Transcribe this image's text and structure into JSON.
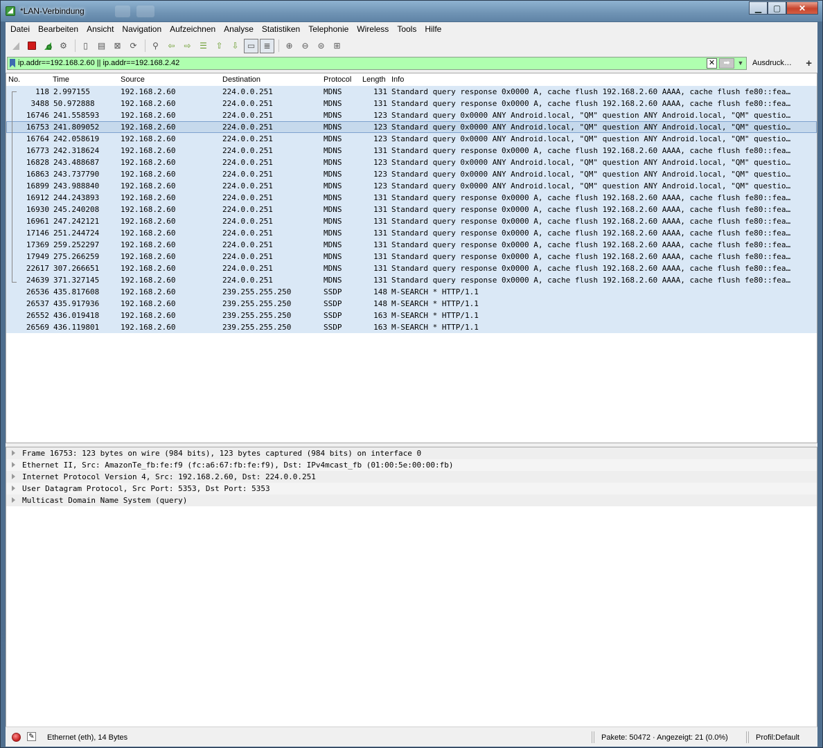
{
  "window": {
    "title": "*LAN-Verbindung"
  },
  "menu": [
    "Datei",
    "Bearbeiten",
    "Ansicht",
    "Navigation",
    "Aufzeichnen",
    "Analyse",
    "Statistiken",
    "Telephonie",
    "Wireless",
    "Tools",
    "Hilfe"
  ],
  "toolbar": {
    "icons": [
      "shark-fin-icon",
      "stop-capture-icon",
      "restart-capture-icon",
      "capture-options-icon",
      "open-file-icon",
      "save-file-icon",
      "close-file-icon",
      "reload-file-icon",
      "find-packet-icon",
      "go-back-icon",
      "go-forward-icon",
      "go-to-packet-icon",
      "first-packet-icon",
      "last-packet-icon",
      "autoscroll-icon",
      "colorize-icon",
      "zoom-in-icon",
      "zoom-out-icon",
      "normal-size-icon",
      "resize-columns-icon"
    ]
  },
  "filter": {
    "value": "ip.addr==192.168.2.60 || ip.addr==192.168.2.42",
    "expression_label": "Ausdruck…",
    "add_label": "+"
  },
  "packet_list": {
    "columns": [
      "No.",
      "Time",
      "Source",
      "Destination",
      "Protocol",
      "Length",
      "Info"
    ],
    "selected_index": 3,
    "rows": [
      {
        "no": "118",
        "time": "2.997155",
        "src": "192.168.2.60",
        "dst": "224.0.0.251",
        "proto": "MDNS",
        "len": "131",
        "info": "Standard query response 0x0000 A, cache flush 192.168.2.60 AAAA, cache flush fe80::fea…"
      },
      {
        "no": "3488",
        "time": "50.972888",
        "src": "192.168.2.60",
        "dst": "224.0.0.251",
        "proto": "MDNS",
        "len": "131",
        "info": "Standard query response 0x0000 A, cache flush 192.168.2.60 AAAA, cache flush fe80::fea…"
      },
      {
        "no": "16746",
        "time": "241.558593",
        "src": "192.168.2.60",
        "dst": "224.0.0.251",
        "proto": "MDNS",
        "len": "123",
        "info": "Standard query 0x0000 ANY Android.local, \"QM\" question ANY Android.local, \"QM\" questio…"
      },
      {
        "no": "16753",
        "time": "241.809052",
        "src": "192.168.2.60",
        "dst": "224.0.0.251",
        "proto": "MDNS",
        "len": "123",
        "info": "Standard query 0x0000 ANY Android.local, \"QM\" question ANY Android.local, \"QM\" questio…"
      },
      {
        "no": "16764",
        "time": "242.058619",
        "src": "192.168.2.60",
        "dst": "224.0.0.251",
        "proto": "MDNS",
        "len": "123",
        "info": "Standard query 0x0000 ANY Android.local, \"QM\" question ANY Android.local, \"QM\" questio…"
      },
      {
        "no": "16773",
        "time": "242.318624",
        "src": "192.168.2.60",
        "dst": "224.0.0.251",
        "proto": "MDNS",
        "len": "131",
        "info": "Standard query response 0x0000 A, cache flush 192.168.2.60 AAAA, cache flush fe80::fea…"
      },
      {
        "no": "16828",
        "time": "243.488687",
        "src": "192.168.2.60",
        "dst": "224.0.0.251",
        "proto": "MDNS",
        "len": "123",
        "info": "Standard query 0x0000 ANY Android.local, \"QM\" question ANY Android.local, \"QM\" questio…"
      },
      {
        "no": "16863",
        "time": "243.737790",
        "src": "192.168.2.60",
        "dst": "224.0.0.251",
        "proto": "MDNS",
        "len": "123",
        "info": "Standard query 0x0000 ANY Android.local, \"QM\" question ANY Android.local, \"QM\" questio…"
      },
      {
        "no": "16899",
        "time": "243.988840",
        "src": "192.168.2.60",
        "dst": "224.0.0.251",
        "proto": "MDNS",
        "len": "123",
        "info": "Standard query 0x0000 ANY Android.local, \"QM\" question ANY Android.local, \"QM\" questio…"
      },
      {
        "no": "16912",
        "time": "244.243893",
        "src": "192.168.2.60",
        "dst": "224.0.0.251",
        "proto": "MDNS",
        "len": "131",
        "info": "Standard query response 0x0000 A, cache flush 192.168.2.60 AAAA, cache flush fe80::fea…"
      },
      {
        "no": "16930",
        "time": "245.240208",
        "src": "192.168.2.60",
        "dst": "224.0.0.251",
        "proto": "MDNS",
        "len": "131",
        "info": "Standard query response 0x0000 A, cache flush 192.168.2.60 AAAA, cache flush fe80::fea…"
      },
      {
        "no": "16961",
        "time": "247.242121",
        "src": "192.168.2.60",
        "dst": "224.0.0.251",
        "proto": "MDNS",
        "len": "131",
        "info": "Standard query response 0x0000 A, cache flush 192.168.2.60 AAAA, cache flush fe80::fea…"
      },
      {
        "no": "17146",
        "time": "251.244724",
        "src": "192.168.2.60",
        "dst": "224.0.0.251",
        "proto": "MDNS",
        "len": "131",
        "info": "Standard query response 0x0000 A, cache flush 192.168.2.60 AAAA, cache flush fe80::fea…"
      },
      {
        "no": "17369",
        "time": "259.252297",
        "src": "192.168.2.60",
        "dst": "224.0.0.251",
        "proto": "MDNS",
        "len": "131",
        "info": "Standard query response 0x0000 A, cache flush 192.168.2.60 AAAA, cache flush fe80::fea…"
      },
      {
        "no": "17949",
        "time": "275.266259",
        "src": "192.168.2.60",
        "dst": "224.0.0.251",
        "proto": "MDNS",
        "len": "131",
        "info": "Standard query response 0x0000 A, cache flush 192.168.2.60 AAAA, cache flush fe80::fea…"
      },
      {
        "no": "22617",
        "time": "307.266651",
        "src": "192.168.2.60",
        "dst": "224.0.0.251",
        "proto": "MDNS",
        "len": "131",
        "info": "Standard query response 0x0000 A, cache flush 192.168.2.60 AAAA, cache flush fe80::fea…"
      },
      {
        "no": "24639",
        "time": "371.327145",
        "src": "192.168.2.60",
        "dst": "224.0.0.251",
        "proto": "MDNS",
        "len": "131",
        "info": "Standard query response 0x0000 A, cache flush 192.168.2.60 AAAA, cache flush fe80::fea…"
      },
      {
        "no": "26536",
        "time": "435.817608",
        "src": "192.168.2.60",
        "dst": "239.255.255.250",
        "proto": "SSDP",
        "len": "148",
        "info": "M-SEARCH * HTTP/1.1"
      },
      {
        "no": "26537",
        "time": "435.917936",
        "src": "192.168.2.60",
        "dst": "239.255.255.250",
        "proto": "SSDP",
        "len": "148",
        "info": "M-SEARCH * HTTP/1.1"
      },
      {
        "no": "26552",
        "time": "436.019418",
        "src": "192.168.2.60",
        "dst": "239.255.255.250",
        "proto": "SSDP",
        "len": "163",
        "info": "M-SEARCH * HTTP/1.1"
      },
      {
        "no": "26569",
        "time": "436.119801",
        "src": "192.168.2.60",
        "dst": "239.255.255.250",
        "proto": "SSDP",
        "len": "163",
        "info": "M-SEARCH * HTTP/1.1"
      }
    ]
  },
  "packet_details": [
    "Frame 16753: 123 bytes on wire (984 bits), 123 bytes captured (984 bits) on interface 0",
    "Ethernet II, Src: AmazonTe_fb:fe:f9 (fc:a6:67:fb:fe:f9), Dst: IPv4mcast_fb (01:00:5e:00:00:fb)",
    "Internet Protocol Version 4, Src: 192.168.2.60, Dst: 224.0.0.251",
    "User Datagram Protocol, Src Port: 5353, Dst Port: 5353",
    "Multicast Domain Name System (query)"
  ],
  "status": {
    "interface": "Ethernet (eth), 14 Bytes",
    "packets": "Pakete: 50472 · Angezeigt: 21 (0.0%)",
    "profile": "Profil:Default"
  },
  "colors": {
    "row_bg": "#dae8f6",
    "row_selected": "#c6d9ec",
    "filter_valid": "#afffaf"
  }
}
